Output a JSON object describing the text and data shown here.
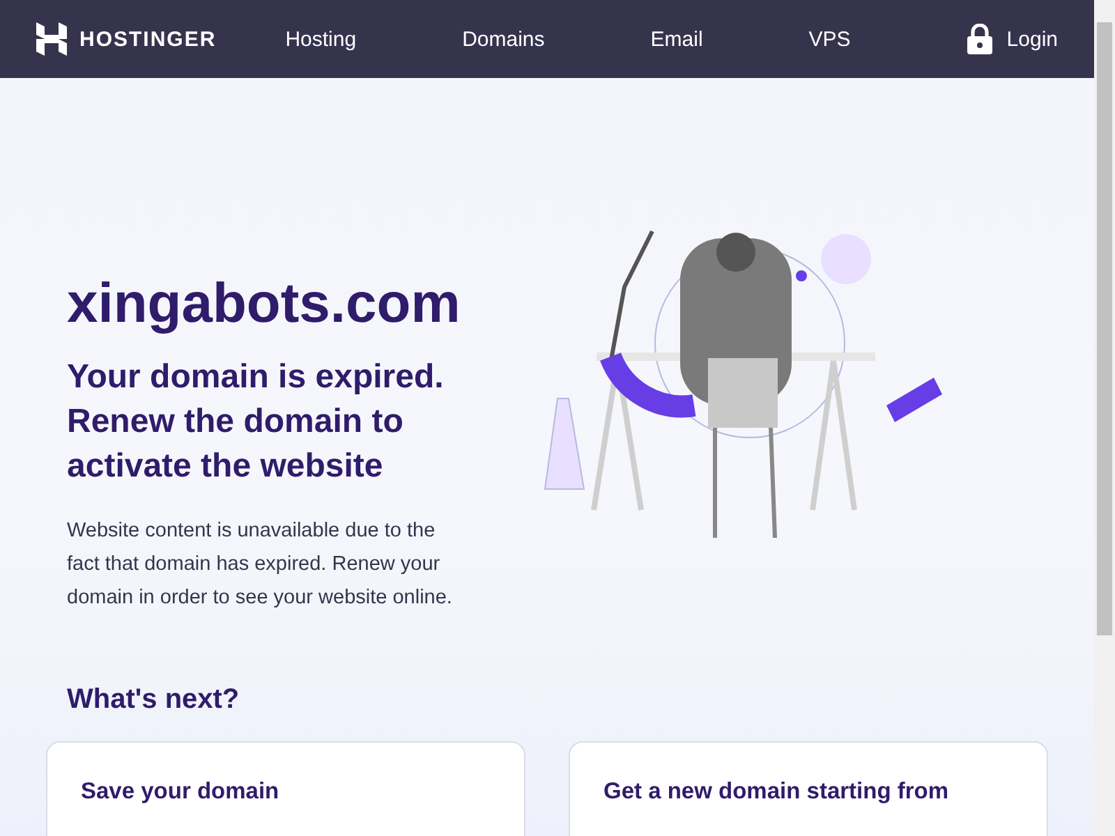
{
  "header": {
    "brand": "HOSTINGER",
    "nav": [
      {
        "label": "Hosting"
      },
      {
        "label": "Domains"
      },
      {
        "label": "Email"
      },
      {
        "label": "VPS"
      }
    ],
    "login": "Login"
  },
  "hero": {
    "domain": "xingabots.com",
    "headline": "Your domain is expired. Renew the domain to activate the website",
    "description": "Website content is unavailable due to the fact that domain has expired. Renew your domain in order to see your website online."
  },
  "next": {
    "title": "What's next?",
    "cards": [
      {
        "title": "Save your domain"
      },
      {
        "title": "Get a new domain starting from"
      }
    ]
  }
}
